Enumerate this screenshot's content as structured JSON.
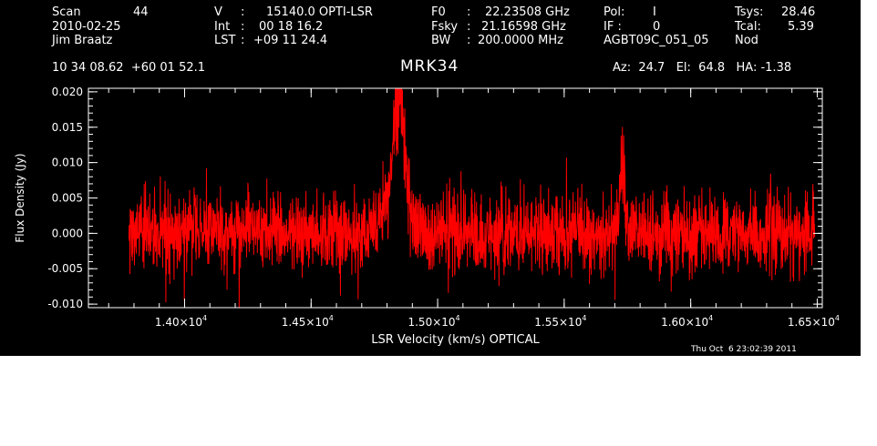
{
  "header": {
    "scan_label": "Scan",
    "scan_value": "44",
    "date": "2010-02-25",
    "observer": "Jim Braatz",
    "v_label": "V",
    "v_value": "15140.0 OPTI-LSR",
    "int_label": "Int",
    "int_value": "00 18 16.2",
    "lst_label": "LST",
    "lst_value": "+09 11 24.4",
    "f0_label": "F0",
    "f0_value": "22.23508 GHz",
    "fsky_label": "Fsky",
    "fsky_value": "21.16598 GHz",
    "bw_label": "BW",
    "bw_value": "200.0000 MHz",
    "pol_label": "Pol:",
    "pol_value": "I",
    "if_label": "IF :",
    "if_value": "0",
    "project": "AGBT09C_051_05",
    "tsys_label": "Tsys:",
    "tsys_value": "28.46",
    "tcal_label": "Tcal:",
    "tcal_value": "5.39",
    "mode": "Nod",
    "coords": "10 34 08.62  +60 01 52.1",
    "source": "MRK34",
    "azel": "Az:  24.7   El:  64.8   HA: -1.38",
    "timestamp": "Thu Oct  6 23:02:39 2011"
  },
  "chart_data": {
    "type": "line",
    "title": "MRK34",
    "xlabel": "LSR Velocity (km/s) OPTICAL",
    "ylabel": "Flux Density (Jy)",
    "xlim": [
      13620,
      16520
    ],
    "ylim": [
      -0.0105,
      0.0205
    ],
    "x_ticks": [
      14000,
      14500,
      15000,
      15500,
      16000,
      16500
    ],
    "x_tick_mantissa": [
      "1.40",
      "1.45",
      "1.50",
      "1.55",
      "1.60",
      "1.65"
    ],
    "x_tick_base": "×10",
    "x_tick_exponent": "4",
    "y_ticks": [
      -0.01,
      -0.005,
      0.0,
      0.005,
      0.01,
      0.015,
      0.02
    ],
    "y_tick_labels": [
      "-0.010",
      "-0.005",
      "0.000",
      "0.005",
      "0.010",
      "0.015",
      "0.020"
    ],
    "series": [
      {
        "color": "#ff0000",
        "x_range": [
          13780,
          16490
        ],
        "noise_rms": 0.0028,
        "features": [
          {
            "center": 14850,
            "peak": 0.0175,
            "width": 20
          },
          {
            "center": 14830,
            "peak": 0.0095,
            "width": 40
          },
          {
            "center": 15730,
            "peak": 0.013,
            "width": 10
          }
        ]
      }
    ],
    "colors": {
      "background": "#000000",
      "axes": "#ffffff",
      "text": "#ffffff",
      "series": "#ff0000"
    }
  }
}
